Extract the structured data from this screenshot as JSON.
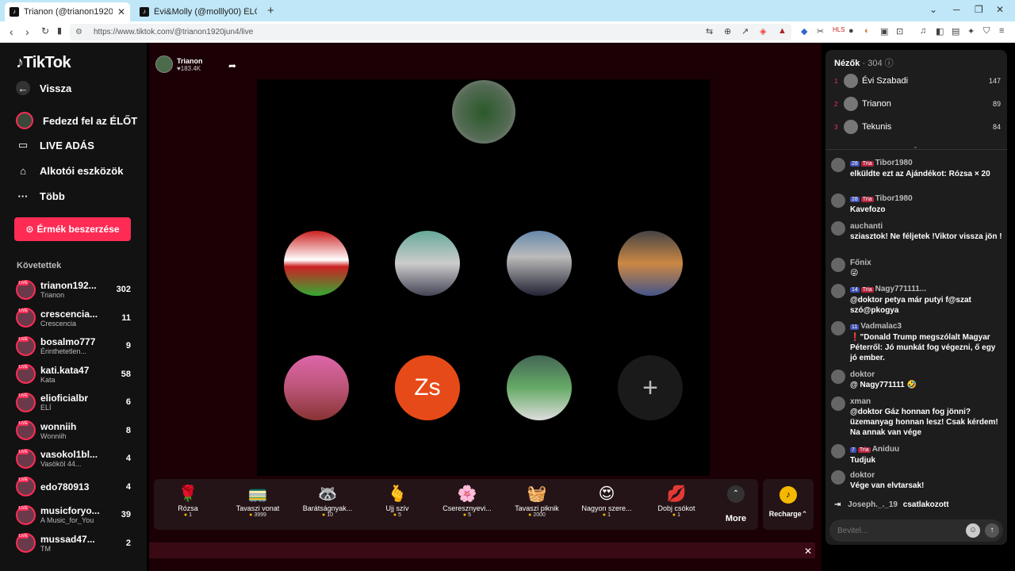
{
  "browser": {
    "tabs": [
      {
        "title": "Trianon (@trianon1920jun4) ÉLŐ",
        "active": true
      },
      {
        "title": "Évi&Molly (@mollly00) ÉLŐ adásban",
        "active": false
      }
    ],
    "url": "https://www.tiktok.com/@trianon1920jun4/live"
  },
  "sidebar": {
    "logo": "TikTok",
    "nav": [
      {
        "label": "Vissza",
        "icon": "back-arrow-icon"
      },
      {
        "label": "Fedezd fel az ÉLŐT",
        "icon": "live-explore-icon"
      },
      {
        "label": "LIVE ADÁS",
        "icon": "camera-icon"
      },
      {
        "label": "Alkotói eszközök",
        "icon": "creator-tools-icon"
      },
      {
        "label": "Több",
        "icon": "more-dots-icon"
      }
    ],
    "coins_button": "Érmék beszerzése",
    "following_heading": "Követettek",
    "following": [
      {
        "name": "trianon192...",
        "sub": "Trianon",
        "count": "302"
      },
      {
        "name": "crescencia...",
        "sub": "Crescencia",
        "count": "11"
      },
      {
        "name": "bosalmo777",
        "sub": "Érinthetetlen...",
        "count": "9"
      },
      {
        "name": "kati.kata47",
        "sub": "Kata",
        "count": "58"
      },
      {
        "name": "elioficialbr",
        "sub": "ELÍ",
        "count": "6"
      },
      {
        "name": "wonniih",
        "sub": "Wonniih",
        "count": "8"
      },
      {
        "name": "vasokol1bl...",
        "sub": "Vasököl 44...",
        "count": "4"
      },
      {
        "name": "edo780913",
        "sub": "",
        "count": "4"
      },
      {
        "name": "musicforyo...",
        "sub": "A Music_for_You",
        "count": "39"
      },
      {
        "name": "mussad47...",
        "sub": "TM",
        "count": "2"
      }
    ]
  },
  "stream": {
    "host_name": "Trianon",
    "host_likes": "183.4K",
    "guests": [
      {
        "name": "guest-1"
      },
      {
        "name": "guest-2"
      },
      {
        "name": "guest-3"
      },
      {
        "name": "guest-4"
      },
      {
        "name": "guest-5"
      },
      {
        "initials": "Zs"
      },
      {
        "name": "guest-7"
      },
      {
        "name": "add-guest"
      }
    ],
    "add_symbol": "+"
  },
  "gifts": [
    {
      "name": "Rózsa",
      "price": "1",
      "icon": "🌹"
    },
    {
      "name": "Tavaszi vonat",
      "price": "3999",
      "icon": "🚃"
    },
    {
      "name": "Barátságnyak...",
      "price": "10",
      "icon": "🦝"
    },
    {
      "name": "Ujj szív",
      "price": "5",
      "icon": "🫰"
    },
    {
      "name": "Cseresznyevi...",
      "price": "5",
      "icon": "🌸"
    },
    {
      "name": "Tavaszi piknik",
      "price": "2000",
      "icon": "🧺"
    },
    {
      "name": "Nagyon szere...",
      "price": "1",
      "icon": "😍"
    },
    {
      "name": "Dobj csókot",
      "price": "1",
      "icon": "💋"
    }
  ],
  "gift_more": "More",
  "recharge": "Recharge",
  "viewers": {
    "title": "Nézők",
    "count": "304",
    "top": [
      {
        "rank": "1",
        "name": "Évi Szabadi",
        "points": "147"
      },
      {
        "rank": "2",
        "name": "Trianon",
        "points": "89"
      },
      {
        "rank": "3",
        "name": "Tekunis",
        "points": "84"
      }
    ]
  },
  "chat": [
    {
      "badges": [
        "28",
        "Tria"
      ],
      "name": "Tibor1980",
      "text": "elküldte ezt az Ajándékot: Rózsa × 20"
    },
    {
      "badges": [
        "28",
        "Tria"
      ],
      "name": "Tibor1980",
      "text": "Kavefozo"
    },
    {
      "badges": [],
      "name": "auchanti",
      "text": "sziasztok! Ne féljetek !Viktor vissza jön !"
    },
    {
      "badges": [],
      "name": "Főnix",
      "text": "😜"
    },
    {
      "badges": [
        "14",
        "Tria"
      ],
      "name": "Nagy771111...",
      "text": "@doktor petya már putyi f@szat szó@pkogya"
    },
    {
      "badges": [
        "11"
      ],
      "name": "Vadmalac3",
      "text": "❗\"Donald Trump megszólalt Magyar Péterről: Jó munkát fog végezni, ő egy jó ember."
    },
    {
      "badges": [],
      "name": "doktor",
      "text": "@ Nagy771111 🤣"
    },
    {
      "badges": [],
      "name": "xman",
      "text": "@doktor Gáz honnan fog jönni? üzemanyag honnan lesz! Csak kérdem! Na annak van vége"
    },
    {
      "badges": [
        "7",
        "Tria"
      ],
      "name": "Aniduu",
      "text": "Tudjuk"
    },
    {
      "badges": [],
      "name": "doktor",
      "text": "Vége van elvtarsak!"
    }
  ],
  "joined": {
    "name": "Joseph._._19",
    "text": "csatlakozott"
  },
  "chat_input": {
    "placeholder": "Bevitel..."
  }
}
